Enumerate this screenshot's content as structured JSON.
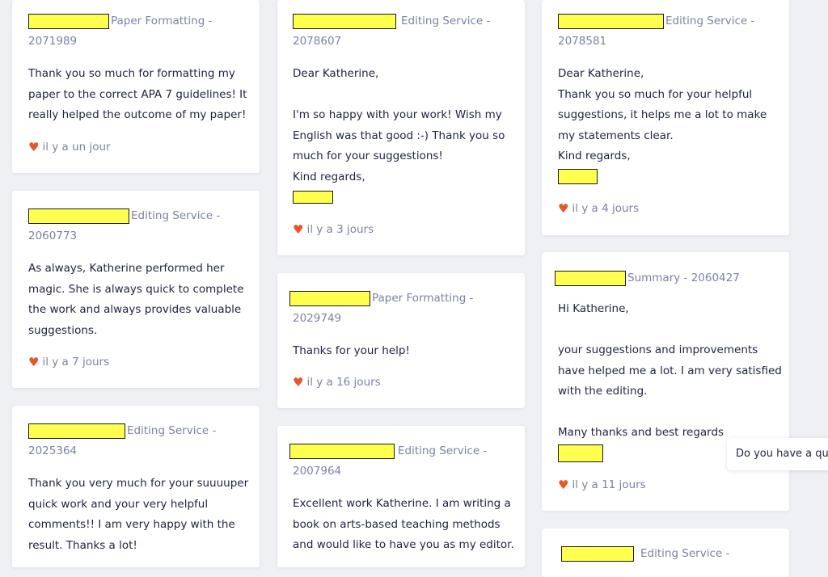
{
  "reviews": [
    {
      "service": "Paper Formatting -",
      "order": "2071989",
      "lines": [
        "Thank you so much for formatting my",
        "paper to the correct APA 7 guidelines! It",
        "really helped the outcome of my paper!"
      ],
      "time": "il y a un jour"
    },
    {
      "service": "Editing Service -",
      "order": "2060773",
      "lines": [
        "As always, Katherine performed her",
        "magic. She is always quick to complete",
        "the work and always provides valuable",
        "suggestions."
      ],
      "time": "il y a 7 jours"
    },
    {
      "service": "Editing Service -",
      "order": "2025364",
      "lines": [
        "Thank you very much for your suuuuper",
        "quick work and your very helpful",
        "comments!! I am very happy with the",
        "result. Thanks a lot!"
      ],
      "time": ""
    },
    {
      "service": "Editing Service -",
      "order": "2078607",
      "lines": [
        "Dear Katherine,",
        "",
        "I'm so happy with your work! Wish my",
        "English was that good :-) Thank you so",
        "much for your suggestions!",
        "Kind regards,"
      ],
      "time": "il y a 3 jours"
    },
    {
      "service": "Paper Formatting -",
      "order": "2029749",
      "lines": [
        "Thanks for your help!"
      ],
      "time": "il y a 16 jours"
    },
    {
      "service": "Editing Service -",
      "order": "2007964",
      "lines": [
        "Excellent work Katherine. I am writing a",
        "book on arts-based teaching methods",
        "and would like to have you as my editor."
      ],
      "time": ""
    },
    {
      "service": "Editing Service -",
      "order": "2078581",
      "lines": [
        "Dear Katherine,",
        "Thank you so much for your helpful",
        "suggestions, it helps me a lot to make",
        "my statements clear.",
        "Kind regards,"
      ],
      "time": "il y a 4 jours"
    },
    {
      "service": "Summary - 2060427",
      "order": "",
      "lines": [
        "Hi Katherine,",
        "",
        "your suggestions and improvements",
        "have helped me a lot. I am very satisfied",
        "with the editing.",
        "",
        "Many thanks and best regards"
      ],
      "time": "il y a 11 jours"
    },
    {
      "service": "Editing Service -",
      "order": "",
      "lines": [],
      "time": ""
    }
  ],
  "chat_tooltip": "Do you have a que",
  "colors": {
    "accent_heart": "#e5572b",
    "redaction": "#ffff4d",
    "muted_text": "#7b82a3"
  }
}
